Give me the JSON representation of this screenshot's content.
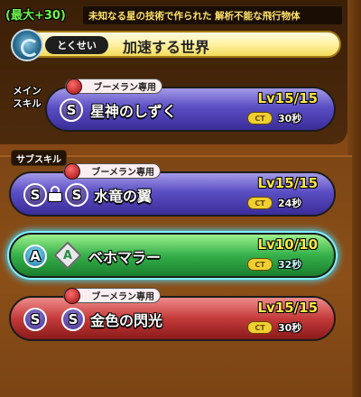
{
  "header": {
    "plus_badge": "(最大+30)",
    "description": "未知なる星の技術で作られた 解析不能な飛行物体"
  },
  "trait": {
    "tag": "とくせい",
    "name": "加速する世界"
  },
  "main_skill": {
    "label_line1": "メイン",
    "label_line2": "スキル",
    "restriction": "ブーメラン専用",
    "grade": "S",
    "name": "星神のしずく",
    "level": "Lv15/15",
    "ct_label": "CT",
    "ct_value": "30秒",
    "color": "#5b4ec4"
  },
  "sub_skill_label": "サブスキル",
  "sub_skills": [
    {
      "restriction": "ブーメラン専用",
      "grade": "S",
      "locked": true,
      "name": "水竜の翼",
      "level": "Lv15/15",
      "ct_label": "CT",
      "ct_value": "24秒",
      "color": "#5b4ec4"
    },
    {
      "restriction": "",
      "grade": "A",
      "locked": false,
      "selected": true,
      "name": "ベホマラー",
      "level": "Lv10/10",
      "ct_label": "CT",
      "ct_value": "32秒",
      "color": "#35b04a"
    },
    {
      "restriction": "ブーメラン専用",
      "grade": "S",
      "locked": false,
      "name": "金色の閃光",
      "level": "Lv15/15",
      "ct_label": "CT",
      "ct_value": "30秒",
      "color": "#c43a3a"
    }
  ]
}
